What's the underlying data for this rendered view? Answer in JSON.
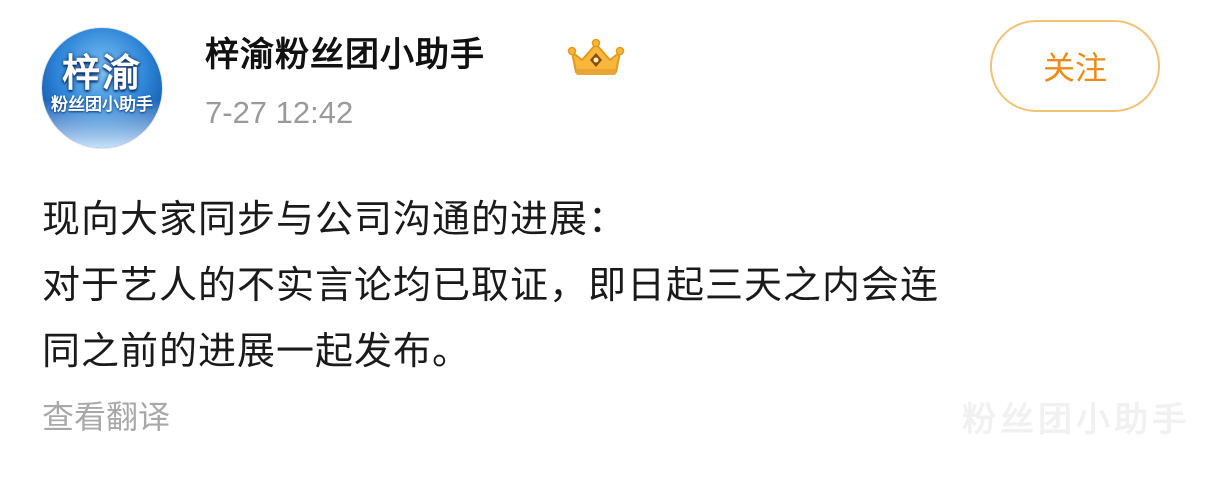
{
  "post": {
    "author": {
      "avatar_title": "梓渝",
      "avatar_subtitle": "粉丝团小助手",
      "name": "梓渝粉丝团小助手",
      "badge_icon": "crown-icon"
    },
    "timestamp": "7-27 12:42",
    "follow_label": "关注",
    "text_lines": [
      "现向大家同步与公司沟通的进展：",
      "对于艺人的不实言论均已取证，即日起三天之内会连",
      "同之前的进展一起发布。"
    ],
    "translate_label": "查看翻译"
  },
  "watermark": "粉丝团小助手",
  "colors": {
    "accent": "#ef8a16",
    "button_border": "#f3c276",
    "muted_text": "#9a9a9a",
    "avatar_blue": "#2f86d8"
  }
}
